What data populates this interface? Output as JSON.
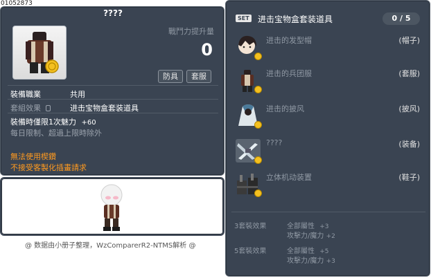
{
  "item_id": "01052873",
  "item_name": "????",
  "power": {
    "label": "戰鬥力提升量",
    "value": "0"
  },
  "tags": {
    "armor": "防具",
    "suit": "套服"
  },
  "job": {
    "label": "裝備職業",
    "value": "共用"
  },
  "set_effect": {
    "label": "套組效果",
    "value": "进击宝物盒套装道具"
  },
  "charm": {
    "label": "裝備時僅限1次魅力",
    "value": "+60"
  },
  "limit_note": "每日限制、超過上限時除外",
  "warnings": [
    "無法使用楔鑽",
    "不接受客製化插畫請求"
  ],
  "credit": "@ 数据由小册子整理，WzComparerR2-NTMS解析 @",
  "set_panel": {
    "badge": "SET",
    "title": "进击宝物盒套装道具",
    "count": "0 / 5",
    "items": [
      {
        "name": "进击的发型帽",
        "type": "(帽子)",
        "icon": "hat-icon"
      },
      {
        "name": "进击的兵团服",
        "type": "(套服)",
        "icon": "overall-icon"
      },
      {
        "name": "进击的披风",
        "type": "(披风)",
        "icon": "cape-icon"
      },
      {
        "name": "????",
        "type": "(装备)",
        "icon": "blades-icon"
      },
      {
        "name": "立体机动装置",
        "type": "(鞋子)",
        "icon": "gear-device-icon"
      }
    ],
    "effects": [
      {
        "label": "3套裝效果",
        "stats": [
          {
            "name": "全部屬性",
            "value": "+3"
          },
          {
            "name": "攻擊力/魔力",
            "value": "+2"
          }
        ]
      },
      {
        "label": "5套裝效果",
        "stats": [
          {
            "name": "全部屬性",
            "value": "+5"
          },
          {
            "name": "攻擊力/魔力",
            "value": "+3"
          }
        ]
      }
    ]
  },
  "colors": {
    "panel": "#3a4452",
    "warning": "#ff9a1f",
    "muted": "#8f98a3"
  }
}
